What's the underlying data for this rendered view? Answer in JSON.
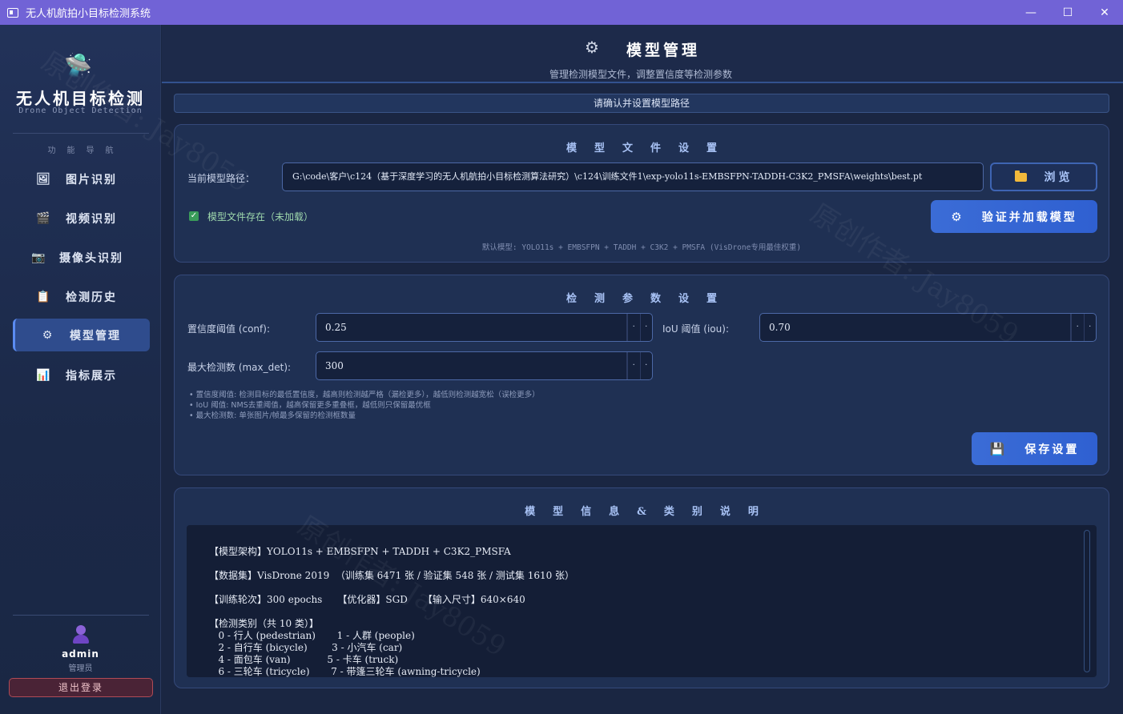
{
  "window": {
    "title": "无人机航拍小目标检测系统",
    "controls": [
      "—",
      "☐",
      "✕"
    ]
  },
  "sidebar": {
    "logo_icon": "🛸",
    "brand_title": "无人机目标检测",
    "brand_subtitle": "Drone Object Detection",
    "nav_heading": "功能导航",
    "items": [
      {
        "icon": "image-icon",
        "glyph": "🖼",
        "label": "图片识别",
        "active": false
      },
      {
        "icon": "video-icon",
        "glyph": "🎬",
        "label": "视频识别",
        "active": false
      },
      {
        "icon": "camera-icon",
        "glyph": "📷",
        "label": "摄像头识别",
        "active": false
      },
      {
        "icon": "history-icon",
        "glyph": "📋",
        "label": "检测历史",
        "active": false
      },
      {
        "icon": "gear-icon",
        "glyph": "⚙",
        "label": "模型管理",
        "active": true
      },
      {
        "icon": "chart-icon",
        "glyph": "📊",
        "label": "指标展示",
        "active": false
      }
    ],
    "user": {
      "name": "admin",
      "role": "管理员"
    },
    "logout_label": "退出登录"
  },
  "header": {
    "icon": "⚙",
    "title": "模型管理",
    "subtitle": "管理检测模型文件，调整置信度等检测参数"
  },
  "notice": "请确认并设置模型路径",
  "model_file": {
    "title": "模型文件设置",
    "path_label": "当前模型路径：",
    "path_value": "G:\\code\\客户\\c124（基于深度学习的无人机航拍小目标检测算法研究）\\c124\\训练文件1\\exp-yolo11s-EMBSFPN-TADDH-C3K2_PMSFA\\weights\\best.pt",
    "browse_label": "浏览",
    "status_check": "✓",
    "status_text": "模型文件存在（未加载）",
    "load_button": "验证并加载模型",
    "default_note": "默认模型: YOLO11s + EMBSFPN + TADDH + C3K2 + PMSFA (VisDrone专用最佳权重)"
  },
  "params": {
    "title": "检测参数设置",
    "conf_label": "置信度阈值 (conf):",
    "conf_value": "0.25",
    "iou_label": "IoU 阈值 (iou):",
    "iou_value": "0.70",
    "maxdet_label": "最大检测数 (max_det):",
    "maxdet_value": "300",
    "hints": [
      "• 置信度阈值: 检测目标的最低置信度，越高则检测越严格（漏检更多），越低则检测越宽松（误检更多）",
      "• IoU 阈值: NMS去重阈值，越高保留更多重叠框，越低则只保留最优框",
      "• 最大检测数: 单张图片/帧最多保留的检测框数量"
    ],
    "save_button": "保存设置"
  },
  "info": {
    "title": "模型信息&类别说明",
    "lines": [
      "【模型架构】YOLO11s + EMBSFPN + TADDH + C3K2_PMSFA",
      "【数据集】VisDrone 2019  （训练集 6471 张 / 验证集 548 张 / 测试集 1610 张）",
      "【训练轮次】300 epochs     【优化器】SGD     【输入尺寸】640×640",
      "【检测类别（共 10 类）】",
      "   0 - 行人 (pedestrian)       1 - 人群 (people)",
      "   2 - 自行车 (bicycle)        3 - 小汽车 (car)",
      "   4 - 面包车 (van)            5 - 卡车 (truck)",
      "   6 - 三轮车 (tricycle)       7 - 带篷三轮车 (awning-tricycle)"
    ]
  },
  "watermark": "原创作者: Jay8059"
}
